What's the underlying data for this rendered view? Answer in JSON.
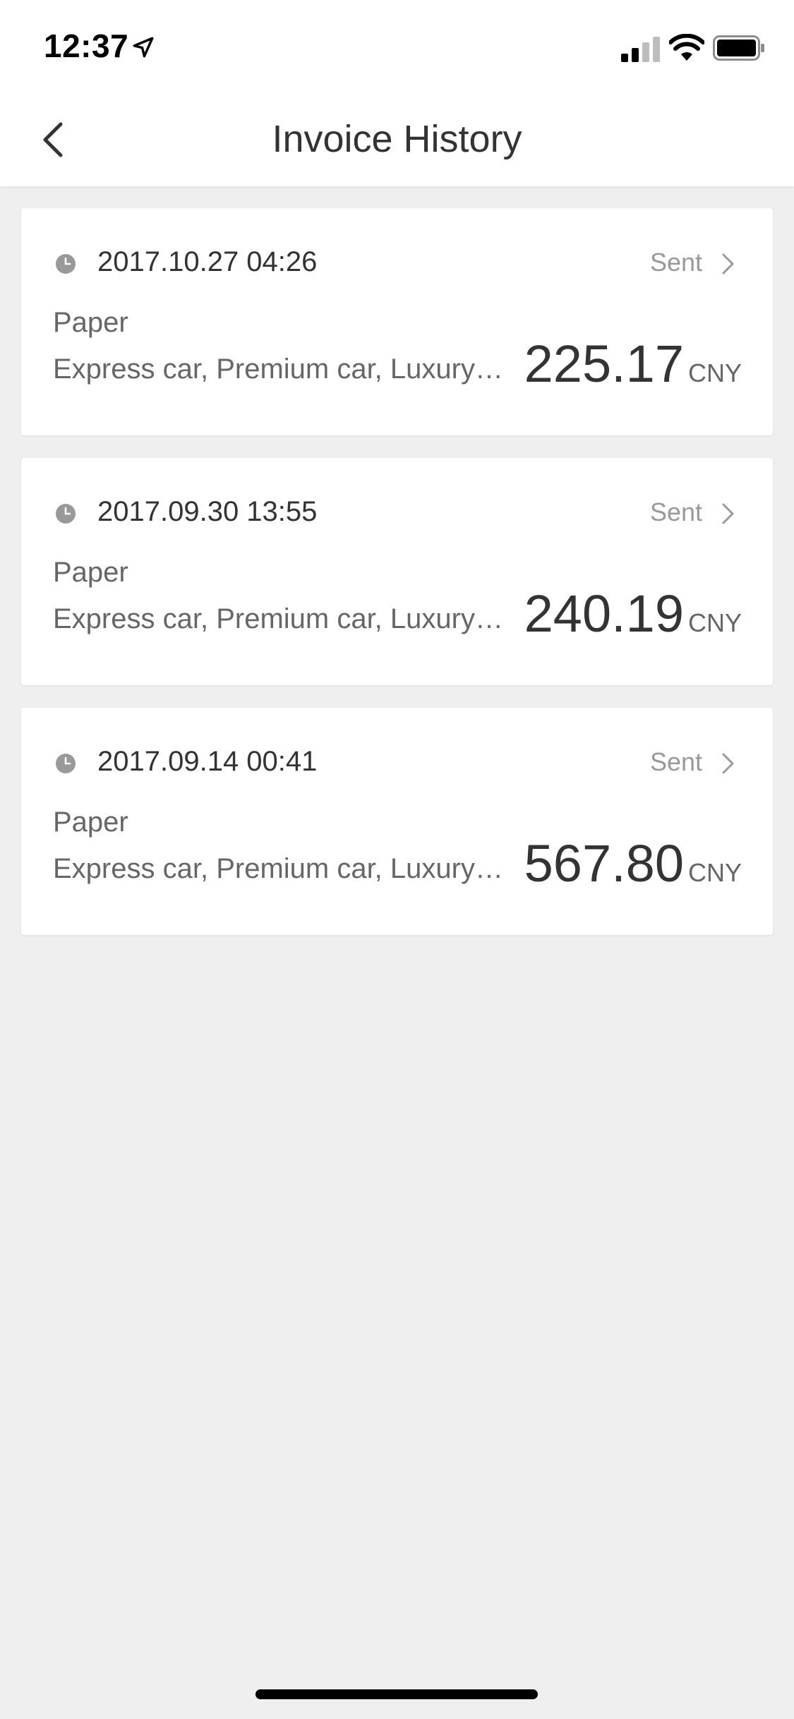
{
  "status_bar": {
    "time": "12:37",
    "icons": [
      "location-arrow-icon",
      "cellular-signal-icon",
      "wifi-icon",
      "battery-icon"
    ]
  },
  "nav": {
    "title": "Invoice History",
    "back_icon": "chevron-left-icon"
  },
  "invoices": [
    {
      "date": "2017.10.27 04:26",
      "status": "Sent",
      "type": "Paper",
      "description": "Express car, Premium car, Luxury…",
      "amount": "225.17",
      "currency": "CNY"
    },
    {
      "date": "2017.09.30 13:55",
      "status": "Sent",
      "type": "Paper",
      "description": "Express car, Premium car, Luxury…",
      "amount": "240.19",
      "currency": "CNY"
    },
    {
      "date": "2017.09.14 00:41",
      "status": "Sent",
      "type": "Paper",
      "description": "Express car, Premium car, Luxury…",
      "amount": "567.80",
      "currency": "CNY"
    }
  ],
  "colors": {
    "background": "#efefef",
    "card": "#ffffff",
    "text_primary": "#333333",
    "text_secondary": "#666666",
    "text_muted": "#999999"
  }
}
